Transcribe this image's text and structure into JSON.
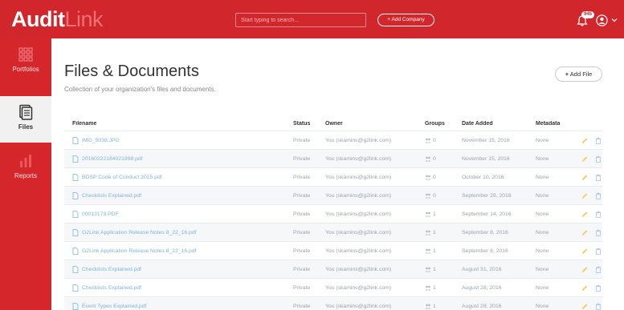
{
  "header": {
    "logo_part1": "Audit",
    "logo_part2": "Link",
    "search_placeholder": "Start typing to search...",
    "add_company_label": "+ Add Company",
    "notification_count": "945"
  },
  "sidebar": {
    "items": [
      {
        "label": "Portfolios",
        "icon": "grid-icon",
        "active": false
      },
      {
        "label": "Files",
        "icon": "document-icon",
        "active": true
      },
      {
        "label": "Reports",
        "icon": "chart-icon",
        "active": false
      }
    ]
  },
  "main": {
    "title": "Files & Documents",
    "subtitle": "Collection of your organization's files and documents.",
    "add_file_label": "Add File"
  },
  "table": {
    "columns": [
      "Filename",
      "Status",
      "Owner",
      "Groups",
      "Date Added",
      "Metadata"
    ],
    "rows": [
      {
        "filename": "IMG_5038.JPG",
        "status": "Private",
        "owner": "You (skamins@g2link.com)",
        "groups": "0",
        "date": "November 15, 2016",
        "metadata": "None"
      },
      {
        "filename": "20160222184021998.pdf",
        "status": "Private",
        "owner": "You (skamins@g2link.com)",
        "groups": "0",
        "date": "November 15, 2016",
        "metadata": "None"
      },
      {
        "filename": "BDSP Code of Conduct 2015.pdf",
        "status": "Private",
        "owner": "You (skamins@g2link.com)",
        "groups": "0",
        "date": "October 10, 2016",
        "metadata": "None"
      },
      {
        "filename": "Checklists Explained.pdf",
        "status": "Private",
        "owner": "You (skamins@g2link.com)",
        "groups": "0",
        "date": "September 29, 2016",
        "metadata": "None"
      },
      {
        "filename": "00013173.PDF",
        "status": "Private",
        "owner": "You (skamins@g2link.com)",
        "groups": "1",
        "date": "September 14, 2016",
        "metadata": "None"
      },
      {
        "filename": "G2Link Application Release Notes 8_22_16.pdf",
        "status": "Private",
        "owner": "You (skamins@g2link.com)",
        "groups": "1",
        "date": "September 8, 2016",
        "metadata": "None"
      },
      {
        "filename": "G2Link Application Release Notes 8_22_16.pdf",
        "status": "Private",
        "owner": "You (skamins@g2link.com)",
        "groups": "1",
        "date": "September 8, 2016",
        "metadata": "None"
      },
      {
        "filename": "Checklists Explained.pdf",
        "status": "Private",
        "owner": "You (skamins@g2link.com)",
        "groups": "1",
        "date": "August 31, 2016",
        "metadata": "None"
      },
      {
        "filename": "Checklists Explained.pdf",
        "status": "Private",
        "owner": "You (skamins@g2link.com)",
        "groups": "1",
        "date": "August 28, 2016",
        "metadata": "None"
      },
      {
        "filename": "Event Types Explained.pdf",
        "status": "Private",
        "owner": "You (skamins@g2link.com)",
        "groups": "1",
        "date": "August 28, 2016",
        "metadata": "None"
      }
    ]
  },
  "colors": {
    "brand_red": "#d0262c",
    "link_blue": "#7eb4d8",
    "action_yellow": "#f2c94c"
  }
}
